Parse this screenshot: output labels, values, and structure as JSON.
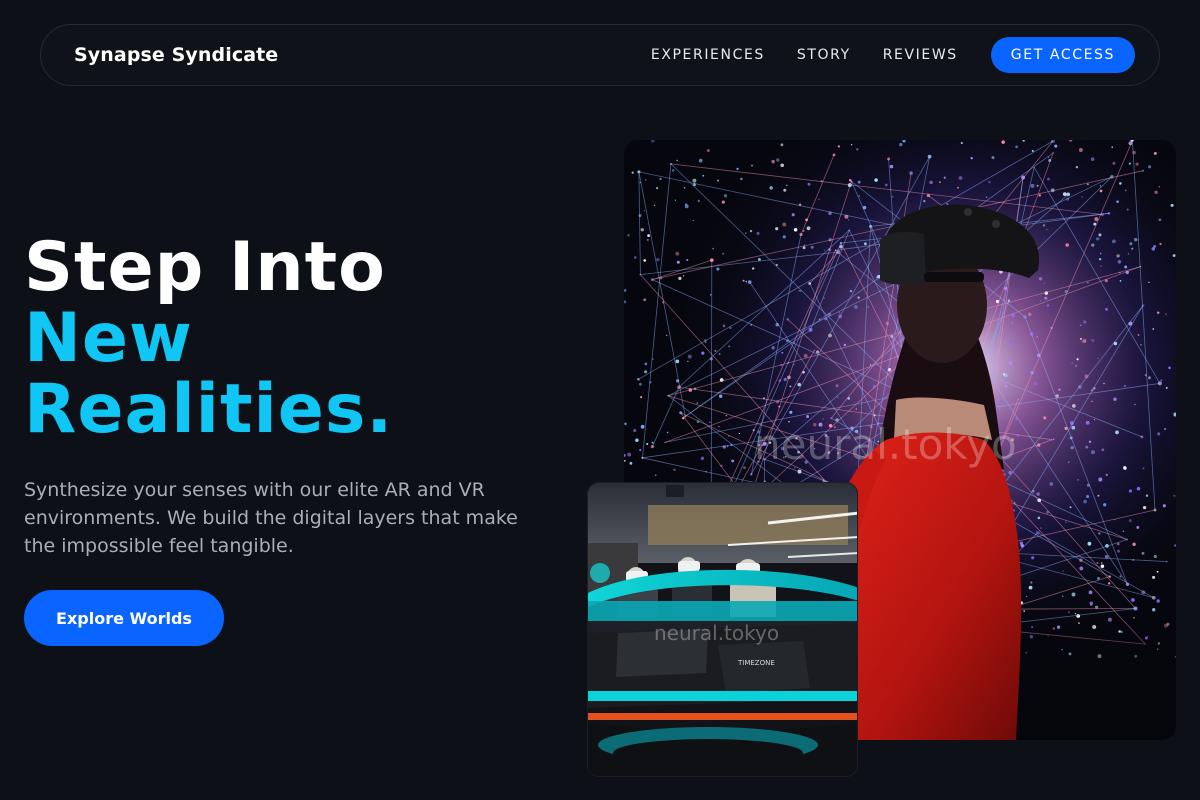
{
  "nav": {
    "brand": "Synapse Syndicate",
    "links": [
      {
        "label": "EXPERIENCES"
      },
      {
        "label": "STORY"
      },
      {
        "label": "REVIEWS"
      }
    ],
    "cta_label": "GET ACCESS"
  },
  "hero": {
    "title_line1": "Step Into",
    "title_accent_line1": "New",
    "title_accent_line2": "Realities.",
    "subtitle": "Synthesize your senses with our elite AR and VR environments. We build the digital layers that make the impossible feel tangible.",
    "button_label": "Explore Worlds"
  },
  "images": {
    "main_watermark": "neural.tokyo",
    "small_watermark": "neural.tokyo",
    "small_sign": "TIMEZONE"
  },
  "colors": {
    "background": "#0d1016",
    "accent_blue": "#0a64ff",
    "accent_cyan": "#10c6f5",
    "muted_text": "#a9aeb8"
  }
}
